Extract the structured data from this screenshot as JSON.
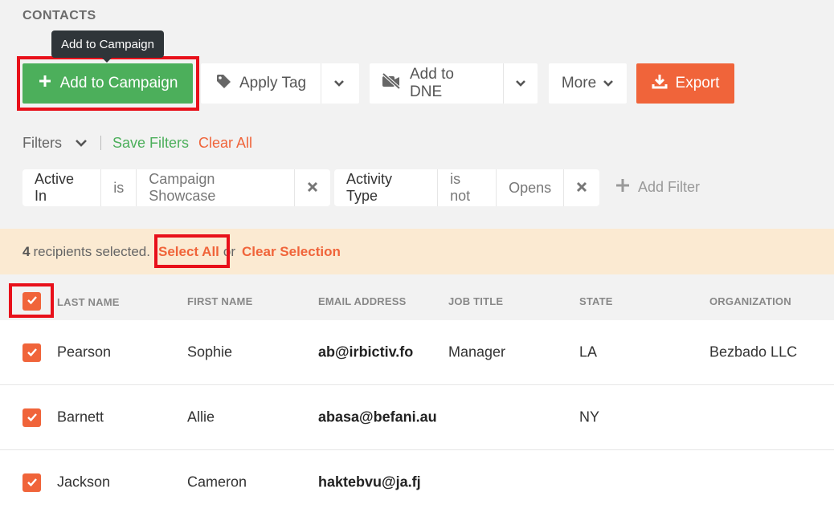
{
  "page": {
    "title": "CONTACTS"
  },
  "tooltip": {
    "text": "Add to Campaign"
  },
  "toolbar": {
    "add_to_campaign": "Add to Campaign",
    "apply_tag": "Apply Tag",
    "add_to_dne": "Add to DNE",
    "more": "More",
    "export": "Export"
  },
  "filters": {
    "label": "Filters",
    "save": "Save Filters",
    "clear_all": "Clear All",
    "chips": [
      {
        "field": "Active In",
        "operator": "is",
        "value": "Campaign Showcase"
      },
      {
        "field": "Activity Type",
        "operator": "is not",
        "value": "Opens"
      }
    ],
    "add_filter": "Add Filter"
  },
  "selection": {
    "count": "4",
    "text": "recipients selected.",
    "select_all": "Select All",
    "or": "or",
    "clear_selection": "Clear Selection"
  },
  "table": {
    "columns": [
      "LAST NAME",
      "FIRST NAME",
      "EMAIL ADDRESS",
      "JOB TITLE",
      "STATE",
      "ORGANIZATION"
    ],
    "rows": [
      {
        "last_name": "Pearson",
        "first_name": "Sophie",
        "email": "ab@irbictiv.fo",
        "job_title": "Manager",
        "state": "LA",
        "organization": "Bezbado LLC"
      },
      {
        "last_name": "Barnett",
        "first_name": "Allie",
        "email": "abasa@befani.au",
        "job_title": "",
        "state": "NY",
        "organization": ""
      },
      {
        "last_name": "Jackson",
        "first_name": "Cameron",
        "email": "haktebvu@ja.fj",
        "job_title": "",
        "state": "",
        "organization": ""
      }
    ]
  },
  "colors": {
    "green": "#4caf5b",
    "orange": "#f0643a",
    "highlight": "#e8101a",
    "selection_bg": "#fbead2"
  }
}
